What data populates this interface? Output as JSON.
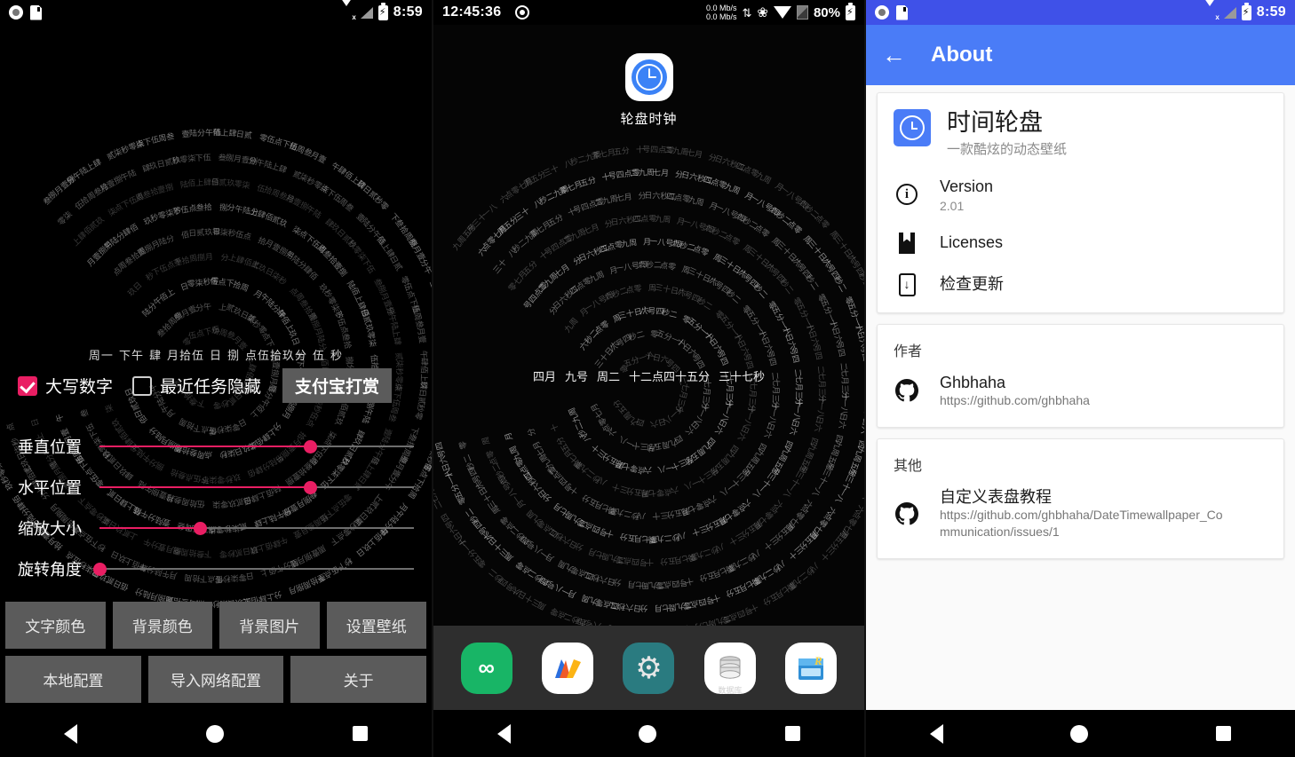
{
  "panel1": {
    "statusbar": {
      "left_icons": [
        "screen-record-icon",
        "sd-card-icon"
      ],
      "right_icons": [
        "wifi-no-internet-icon",
        "signal-icon",
        "battery-charging-icon"
      ],
      "time": "8:59"
    },
    "clock_center": {
      "weekday": "周一",
      "ampm": "下午",
      "month_num": "肆",
      "month_label": "月拾伍",
      "day_label": "日",
      "hour": "捌",
      "minute_label": "点伍拾玖分",
      "second": "伍",
      "second_label": "秒"
    },
    "checkboxes": [
      {
        "label": "大写数字",
        "checked": true
      },
      {
        "label": "最近任务隐藏",
        "checked": false
      }
    ],
    "alipay_button": "支付宝打赏",
    "sliders": [
      {
        "label": "垂直位置",
        "percent": 67
      },
      {
        "label": "水平位置",
        "percent": 67
      },
      {
        "label": "缩放大小",
        "percent": 32
      },
      {
        "label": "旋转角度",
        "percent": 0
      }
    ],
    "buttons_row1": [
      "文字颜色",
      "背景颜色",
      "背景图片",
      "设置壁纸"
    ],
    "buttons_row2": [
      "本地配置",
      "导入网络配置",
      "关于"
    ],
    "navbar": [
      "back-icon",
      "home-icon",
      "recents-icon"
    ],
    "colors": {
      "accent": "#e91e63",
      "button_bg": "#5b5b5b",
      "background": "#000000"
    }
  },
  "panel2": {
    "statusbar": {
      "time": "12:45:36",
      "record_icon": "screen-record-icon",
      "net_up": "0.0 Mb/s",
      "net_down": "0.0 Mb/s",
      "bluetooth": "bluetooth-icon",
      "wifi": "wifi-icon",
      "sim": "no-sim-icon",
      "battery_percent": "80%",
      "battery_icon": "battery-charging-icon"
    },
    "app": {
      "label": "轮盘时钟",
      "icon": "clock-app-icon"
    },
    "clock_center": {
      "month": "四月",
      "day": "九号",
      "weekday": "周二",
      "time": "十二点四十五分",
      "seconds": "三十七秒"
    },
    "drawer_chevron": "chevron-up-icon",
    "dock": [
      {
        "name": "coolapk-icon",
        "glyph": "∞"
      },
      {
        "name": "amap-icon",
        "glyph": "M"
      },
      {
        "name": "settings-icon",
        "glyph": "⚙"
      },
      {
        "name": "database-icon",
        "glyph": "⛃",
        "sublabel": "数据库"
      },
      {
        "name": "rar-icon",
        "glyph": "R"
      }
    ],
    "navbar": [
      "back-icon",
      "home-icon",
      "recents-icon"
    ]
  },
  "panel3": {
    "statusbar": {
      "left_icons": [
        "screen-record-icon",
        "sd-card-icon"
      ],
      "right_icons": [
        "wifi-no-internet-icon",
        "signal-icon",
        "battery-charging-icon"
      ],
      "time": "8:59"
    },
    "appbar": {
      "back": "←",
      "title": "About"
    },
    "app_card": {
      "title": "时间轮盘",
      "subtitle": "一款酷炫的动态壁纸",
      "items": [
        {
          "icon": "info-icon",
          "title": "Version",
          "subtitle": "2.01"
        },
        {
          "icon": "book-icon",
          "title": "Licenses",
          "subtitle": ""
        },
        {
          "icon": "update-icon",
          "title": "检查更新",
          "subtitle": ""
        }
      ]
    },
    "author_card": {
      "heading": "作者",
      "name": "Ghbhaha",
      "url": "https://github.com/ghbhaha",
      "icon": "github-icon"
    },
    "other_card": {
      "heading": "其他",
      "name": "自定义表盘教程",
      "url": "https://github.com/ghbhaha/DateTimewallpaper_Communication/issues/1",
      "icon": "github-icon"
    },
    "navbar": [
      "back-icon",
      "home-icon",
      "recents-icon"
    ],
    "colors": {
      "appbar": "#4a7cf7",
      "statusbar": "#3f51e8",
      "page_bg": "#fafafa"
    }
  }
}
